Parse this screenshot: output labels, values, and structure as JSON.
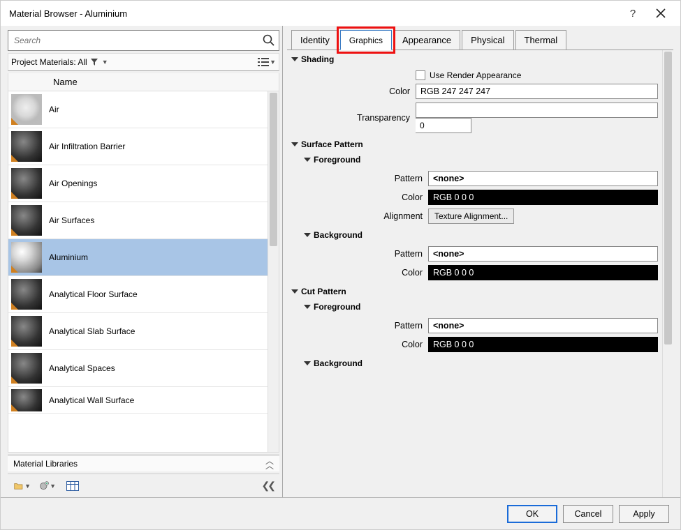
{
  "window": {
    "title": "Material Browser - Aluminium"
  },
  "search": {
    "placeholder": "Search"
  },
  "project_filter": "Project Materials: All",
  "list_header": "Name",
  "materials": [
    {
      "name": "Air"
    },
    {
      "name": "Air Infiltration Barrier"
    },
    {
      "name": "Air Openings"
    },
    {
      "name": "Air Surfaces"
    },
    {
      "name": "Aluminium",
      "selected": true
    },
    {
      "name": "Analytical Floor Surface"
    },
    {
      "name": "Analytical Slab Surface"
    },
    {
      "name": "Analytical Spaces"
    },
    {
      "name": "Analytical Wall Surface"
    }
  ],
  "libraries_label": "Material Libraries",
  "tabs": {
    "identity": "Identity",
    "graphics": "Graphics",
    "appearance": "Appearance",
    "physical": "Physical",
    "thermal": "Thermal"
  },
  "sections": {
    "shading": "Shading",
    "use_render": "Use Render Appearance",
    "color_label": "Color",
    "shading_color": "RGB 247 247 247",
    "transparency_label": "Transparency",
    "transparency_value": "0",
    "surface_pattern": "Surface Pattern",
    "foreground": "Foreground",
    "background": "Background",
    "pattern_label": "Pattern",
    "none": "<none>",
    "rgb000": "RGB 0 0 0",
    "alignment_label": "Alignment",
    "alignment_value": "Texture Alignment...",
    "cut_pattern": "Cut Pattern"
  },
  "footer": {
    "ok": "OK",
    "cancel": "Cancel",
    "apply": "Apply"
  }
}
